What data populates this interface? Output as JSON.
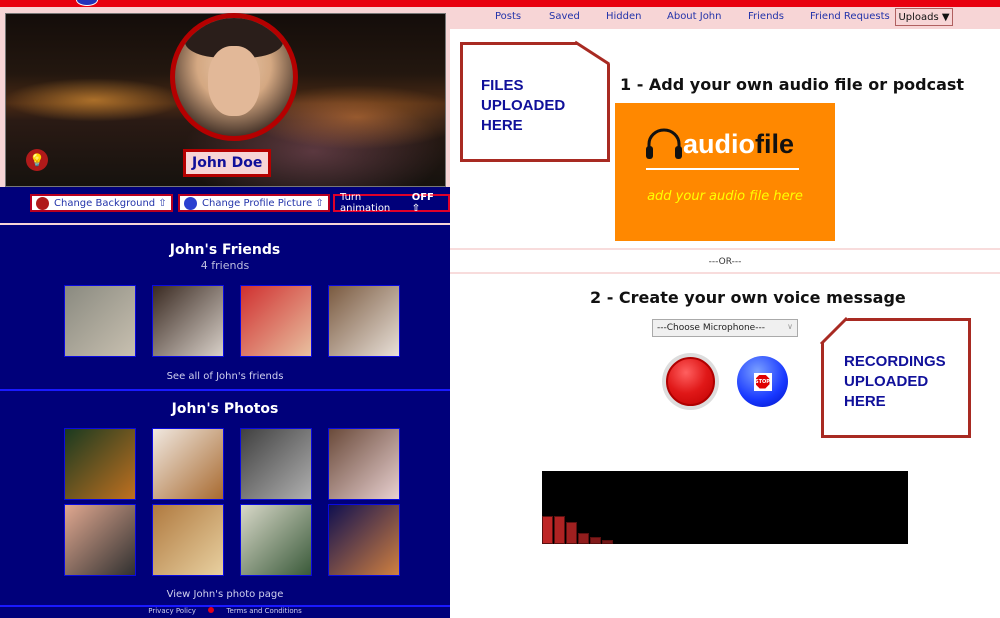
{
  "profile": {
    "name": "John Doe",
    "actions": {
      "change_background": "Change Background ⇧",
      "change_profile_picture": "Change Profile Picture ⇧",
      "animation_prefix": "Turn animation",
      "animation_state": "OFF ⇧"
    }
  },
  "friends": {
    "title": "John's Friends",
    "count_label": "4 friends",
    "see_all": "See all of John's friends",
    "items": [
      {
        "alt": "friend-1",
        "colors": [
          "#8a8a80",
          "#c8c0b0"
        ]
      },
      {
        "alt": "friend-2",
        "colors": [
          "#3a2a22",
          "#d8d0c8"
        ]
      },
      {
        "alt": "friend-3",
        "colors": [
          "#d03030",
          "#e8c0a0"
        ]
      },
      {
        "alt": "friend-4",
        "colors": [
          "#7a5a40",
          "#e8e0d8"
        ]
      }
    ]
  },
  "photos": {
    "title": "John's Photos",
    "view_link": "View John's photo page",
    "items": [
      {
        "alt": "bar-storefront",
        "colors": [
          "#1a3a20",
          "#c07020"
        ]
      },
      {
        "alt": "solar-tree-charger",
        "colors": [
          "#f0e8e0",
          "#a86a30"
        ]
      },
      {
        "alt": "feet-on-street",
        "colors": [
          "#404040",
          "#b0b0b0"
        ]
      },
      {
        "alt": "puppies",
        "colors": [
          "#6a4a3a",
          "#e8d0d0"
        ]
      },
      {
        "alt": "group-faces",
        "colors": [
          "#e0a890",
          "#303030"
        ]
      },
      {
        "alt": "banana-pudding",
        "colors": [
          "#b07a40",
          "#e8d0a0"
        ]
      },
      {
        "alt": "restaurant-front",
        "colors": [
          "#d8d8c8",
          "#3a5a3a"
        ]
      },
      {
        "alt": "cosmic-face",
        "colors": [
          "#101050",
          "#d08040"
        ]
      }
    ]
  },
  "footer": {
    "privacy": "Privacy Policy",
    "terms": "Terms and Conditions"
  },
  "nav": {
    "items": [
      "Posts",
      "Saved",
      "Hidden",
      "About John",
      "Friends",
      "Friend Requests"
    ],
    "uploads": "Uploads ▼"
  },
  "uploads": {
    "files_callout": [
      "FILES",
      "UPLOADED",
      "HERE"
    ],
    "section1_title": "1 - Add your own audio file or podcast",
    "audio_logo_white": "audio",
    "audio_logo_black": "file",
    "audio_sub": "add your audio file here",
    "or_label": "---OR---",
    "section2_title": "2 - Create your own voice message",
    "mic_select": "---Choose Microphone---",
    "stop_label": "STOP",
    "recordings_callout": [
      "RECORDINGS",
      "UPLOADED",
      "HERE"
    ],
    "visualizer_levels": [
      0.38,
      0.38,
      0.3,
      0.15,
      0.1,
      0.05
    ]
  },
  "colors": {
    "brand_red": "#e8000f",
    "navy": "#00007a",
    "pink": "#f7d5d6",
    "audio_orange": "#ff8800",
    "callout_border": "#a82a22"
  }
}
